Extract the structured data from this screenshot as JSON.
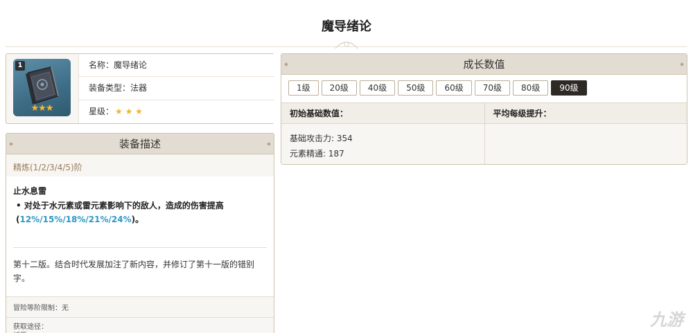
{
  "page": {
    "title": "魔导绪论"
  },
  "item": {
    "rarity_number": "1",
    "stars_icon": "★★★",
    "name_label": "名称：魔导绪论",
    "type_label": "装备类型：法器",
    "rarity_label": "星级：",
    "rarity_stars": "★ ★ ★",
    "star_color": "#f0b52c"
  },
  "description": {
    "header": "装备描述",
    "refinement": "精炼(1/2/3/4/5)阶",
    "passive_name": "止水息雷",
    "passive_text_pre": "• 对处于水元素或雷元素影响下的敌人，造成的伤害提高(",
    "passive_values": "12%/15%/18%/21%/24%",
    "passive_text_post": ")。",
    "lore": "第十二版。结合时代发展加注了新内容，并修订了第十一版的错别字。",
    "ascension_limit": "冒险等阶限制：无",
    "source_label": "获取途径：",
    "source_value": "祈愿",
    "highlight_color": "#2d97c6"
  },
  "growth": {
    "header": "成长数值",
    "levels": [
      "1级",
      "20级",
      "40级",
      "50级",
      "60级",
      "70级",
      "80级",
      "90级"
    ],
    "selected_level": "90级",
    "base_stats_header": "初始基础数值：",
    "avg_growth_header": "平均每级提升：",
    "base_attack": "基础攻击力: 354",
    "elemental_mastery": "元素精通: 187"
  },
  "watermark": "九游"
}
